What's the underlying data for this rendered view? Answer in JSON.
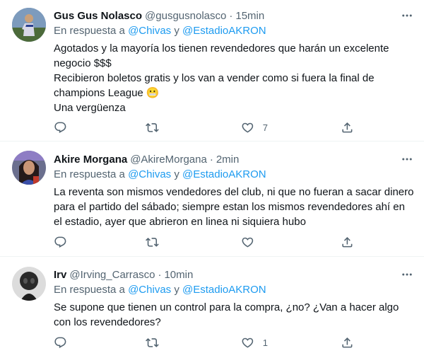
{
  "tweets": [
    {
      "name": "Gus Gus Nolasco",
      "handle": "@gusgusnolasco",
      "time": "15min",
      "reply_prefix": "En respuesta a",
      "mention1": "@Chivas",
      "reply_joiner": "y",
      "mention2": "@EstadioAKRON",
      "text": "Agotados y la mayoría los tienen revendedores que harán un excelente negocio $$$\nRecibieron boletos gratis y los van a vender como si fuera la final de champions League 😬\nUna vergüenza",
      "reply_count": "",
      "retweet_count": "",
      "like_count": "7"
    },
    {
      "name": "Akire Morgana",
      "handle": "@AkireMorgana",
      "time": "2min",
      "reply_prefix": "En respuesta a",
      "mention1": "@Chivas",
      "reply_joiner": "y",
      "mention2": "@EstadioAKRON",
      "text": "La reventa son mismos vendedores del club, ni que no fueran a sacar dinero para el partido del sábado; siempre estan los mismos revendedores ahí en el estadio, ayer que abrieron en linea ni siquiera hubo",
      "reply_count": "",
      "retweet_count": "",
      "like_count": ""
    },
    {
      "name": "Irv",
      "handle": "@Irving_Carrasco",
      "time": "10min",
      "reply_prefix": "En respuesta a",
      "mention1": "@Chivas",
      "reply_joiner": "y",
      "mention2": "@EstadioAKRON",
      "text": "Se supone que tienen un control para la compra, ¿no? ¿Van a hacer algo con los revendedores?",
      "reply_count": "",
      "retweet_count": "",
      "like_count": "1"
    }
  ],
  "colors": {
    "accent": "#1d9bf0",
    "secondary_text": "#536471",
    "primary_text": "#0f1419",
    "divider": "#eff3f4"
  },
  "icons": {
    "more": "more-icon",
    "reply": "reply-icon",
    "retweet": "retweet-icon",
    "like": "heart-icon",
    "share": "share-icon"
  }
}
